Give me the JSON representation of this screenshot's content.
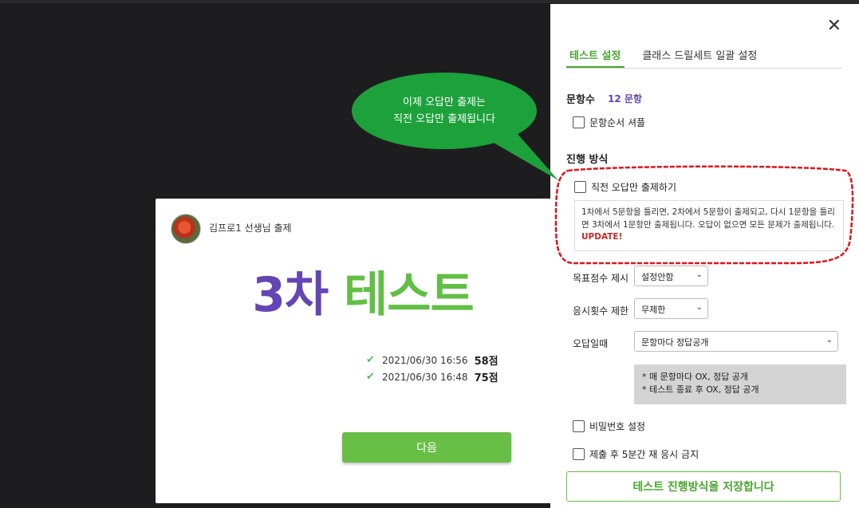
{
  "callout": {
    "line1": "이제 오답만 출제는",
    "line2": "직전 오답만 출제됩니다"
  },
  "card": {
    "teacher": "김프로1 선생님 출제",
    "title_num": "3차",
    "title_word": "테스트",
    "history": [
      {
        "datetime": "2021/06/30 16:56",
        "score": "58점"
      },
      {
        "datetime": "2021/06/30 16:48",
        "score": "75점"
      }
    ],
    "next_label": "다음"
  },
  "panel": {
    "close_icon": "✕",
    "tabs": [
      {
        "label": "테스트 설정",
        "active": true
      },
      {
        "label": "클래스 드릴세트 일괄 설정",
        "active": false
      }
    ],
    "question_count_label": "문항수",
    "question_count_value": "12 문항",
    "shuffle_label": "문항순서 셔플",
    "progress_heading": "진행 방식",
    "prev_wrong_label": "직전 오답만 출제하기",
    "info_text": "1차에서 5문항을 틀리면, 2차에서 5문항이 출제되고, 다시 1문항을 틀리면 3차에서 1문항만 출제됩니다. 오답이 없으면 모든 문제가 출제됩니다.",
    "info_update": "UPDATE!",
    "target_score_label": "목표점수 제시",
    "target_score_value": "설정안함",
    "attempt_limit_label": "응시횟수 제한",
    "attempt_limit_value": "무제한",
    "wrong_answer_label": "오답일때",
    "wrong_answer_value": "문항마다 정답공개",
    "wrong_answer_options": [
      "* 매 문항마다 OX, 정답 공개",
      "* 테스트 종료 후 OX, 정답 공개"
    ],
    "password_label": "비밀번호 설정",
    "retake_ban_label": "제출 후 5분간 재 응시 금지",
    "save_label": "테스트 진행방식을 저장합니다"
  },
  "colors": {
    "accent_green": "#67bf45",
    "accent_purple": "#6445b5",
    "callout_green": "#1da13b",
    "highlight_red": "#e0141c"
  }
}
